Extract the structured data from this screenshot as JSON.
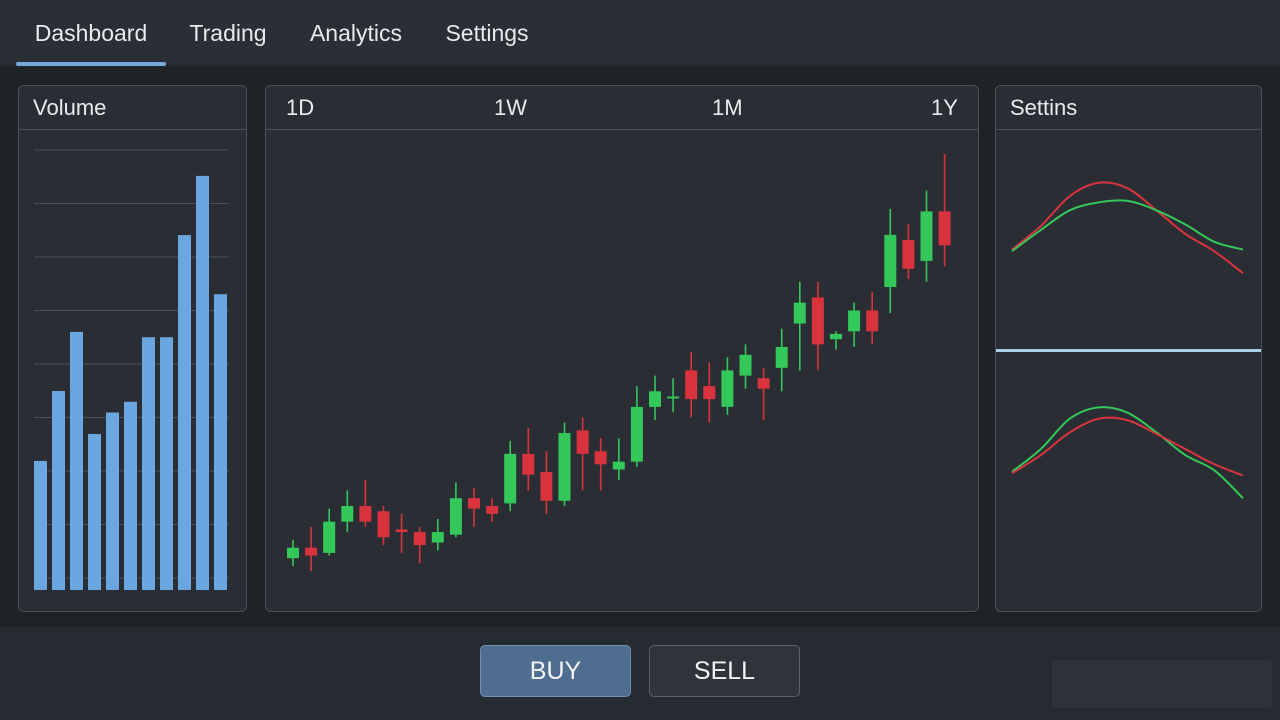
{
  "nav": {
    "tabs": [
      {
        "label": "Dashboard",
        "active": true
      },
      {
        "label": "Trading",
        "active": false
      },
      {
        "label": "Analytics",
        "active": false
      },
      {
        "label": "Settings",
        "active": false
      }
    ]
  },
  "volume_panel": {
    "title": "Volume"
  },
  "price_panel": {
    "ranges": [
      "1D",
      "1W",
      "1M",
      "1Y"
    ]
  },
  "settings_panel": {
    "title": "Settins"
  },
  "actions": {
    "buy_label": "BUY",
    "sell_label": "SELL"
  },
  "colors": {
    "accent": "#74a9dc",
    "bar": "#6aa6e0",
    "up": "#34c759",
    "down": "#d9343d",
    "divider": "#a9cfe8"
  },
  "chart_data": [
    {
      "type": "bar",
      "title": "Volume",
      "values": [
        24,
        37,
        48,
        29,
        33,
        35,
        47,
        47,
        66,
        77,
        55
      ],
      "ylim": [
        0,
        82
      ],
      "grid": true
    },
    {
      "type": "candlestick",
      "ohlc": [
        [
          8,
          12,
          15,
          5
        ],
        [
          12,
          9,
          20,
          3
        ],
        [
          10,
          22,
          27,
          9
        ],
        [
          22,
          28,
          34,
          18
        ],
        [
          28,
          22,
          38,
          20
        ],
        [
          26,
          16,
          28,
          13
        ],
        [
          19,
          18,
          25,
          10
        ],
        [
          18,
          13,
          20,
          6
        ],
        [
          14,
          18,
          23,
          11
        ],
        [
          17,
          31,
          37,
          16
        ],
        [
          31,
          27,
          35,
          20
        ],
        [
          28,
          25,
          31,
          22
        ],
        [
          29,
          48,
          53,
          26
        ],
        [
          48,
          40,
          58,
          34
        ],
        [
          41,
          30,
          49,
          25
        ],
        [
          30,
          56,
          60,
          28
        ],
        [
          57,
          48,
          62,
          34
        ],
        [
          49,
          44,
          54,
          34
        ],
        [
          42,
          45,
          54,
          38
        ],
        [
          45,
          66,
          74,
          43
        ],
        [
          66,
          72,
          78,
          61
        ],
        [
          70,
          70,
          77,
          64
        ],
        [
          80,
          69,
          87,
          62
        ],
        [
          74,
          69,
          83,
          60
        ],
        [
          66,
          80,
          85,
          63
        ],
        [
          78,
          86,
          90,
          73
        ],
        [
          77,
          73,
          81,
          61
        ],
        [
          81,
          89,
          96,
          72
        ],
        [
          98,
          106,
          114,
          80
        ],
        [
          108,
          90,
          114,
          80
        ],
        [
          92,
          94,
          95,
          88
        ],
        [
          95,
          103,
          106,
          89
        ],
        [
          103,
          95,
          110,
          90
        ],
        [
          112,
          132,
          142,
          102
        ],
        [
          130,
          119,
          136,
          115
        ],
        [
          122,
          141,
          149,
          114
        ],
        [
          141,
          128,
          163,
          120
        ]
      ],
      "ylim": [
        0,
        168
      ]
    },
    {
      "type": "line",
      "series": [
        {
          "color": "#d9343d",
          "values": [
            10,
            40,
            78,
            95,
            88,
            60,
            30,
            8,
            -20
          ]
        },
        {
          "color": "#34c759",
          "values": [
            8,
            35,
            60,
            70,
            72,
            60,
            42,
            20,
            10
          ]
        }
      ],
      "ylim": [
        -30,
        110
      ]
    },
    {
      "type": "line",
      "series": [
        {
          "color": "#34c759",
          "values": [
            10,
            40,
            80,
            95,
            88,
            62,
            32,
            12,
            -25
          ]
        },
        {
          "color": "#d9343d",
          "values": [
            8,
            32,
            62,
            80,
            78,
            60,
            40,
            20,
            5
          ]
        }
      ],
      "ylim": [
        -30,
        110
      ]
    }
  ]
}
